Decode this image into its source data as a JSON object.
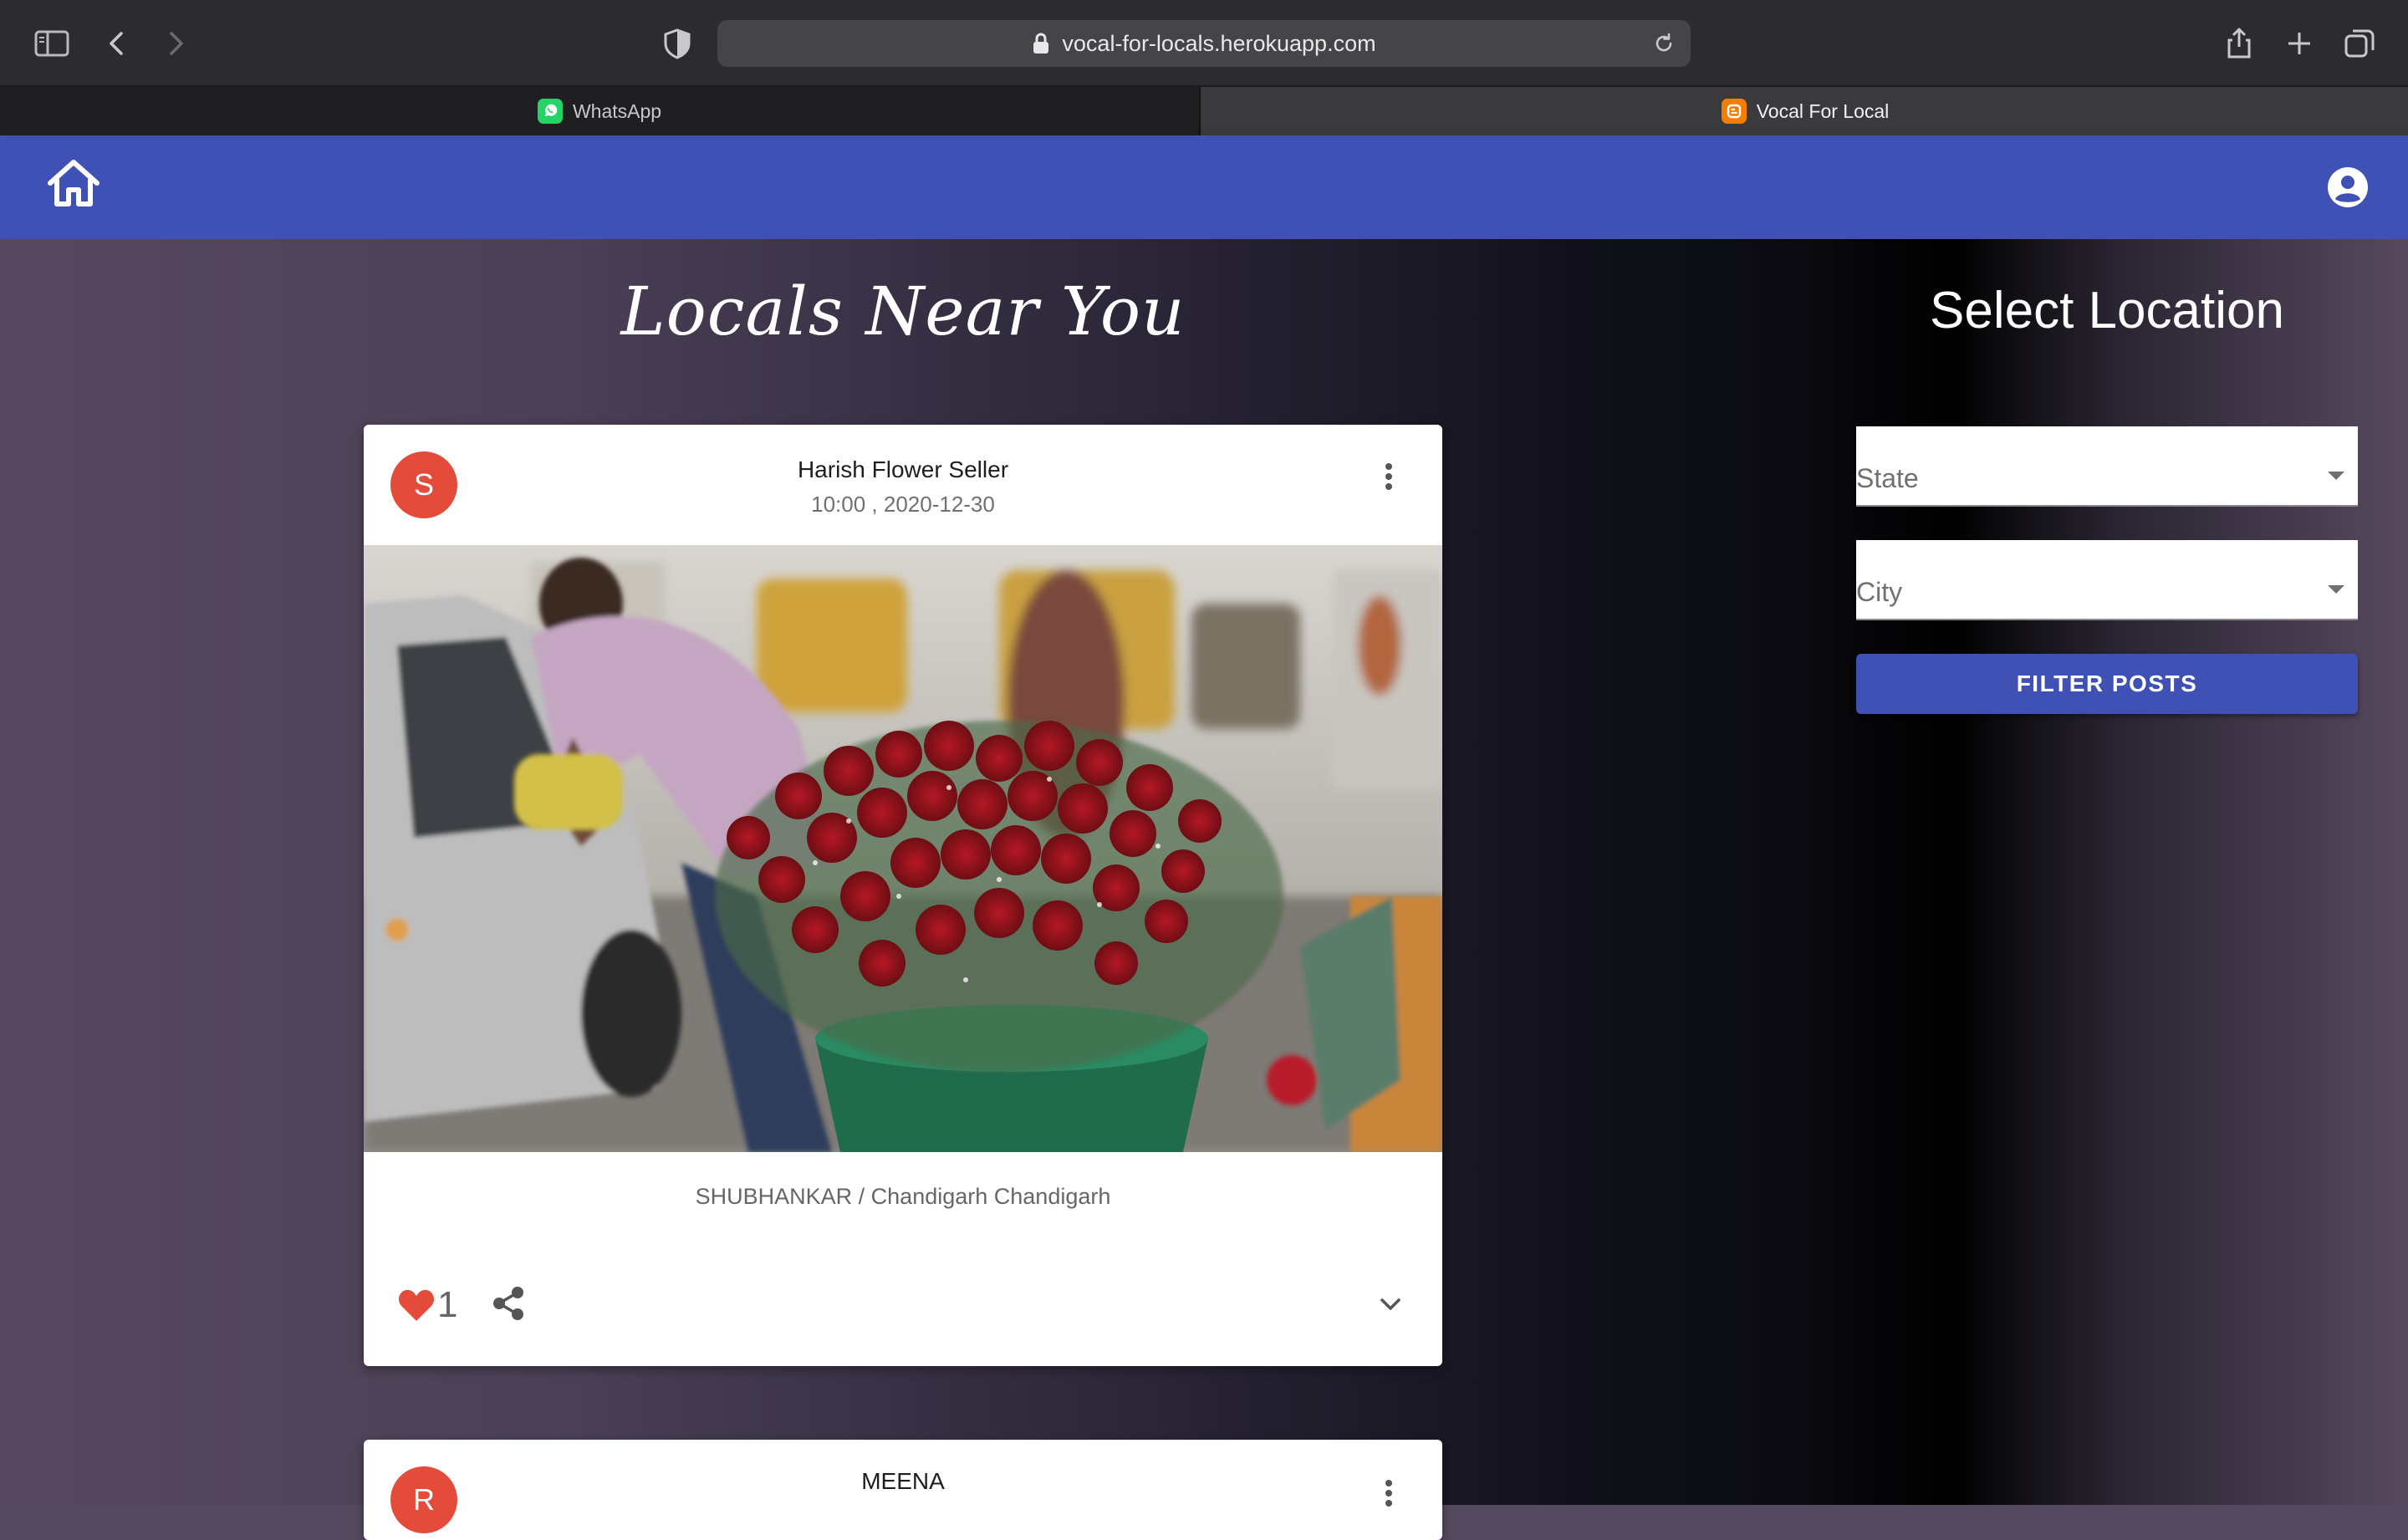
{
  "browser": {
    "url": "vocal-for-locals.herokuapp.com",
    "tabs": [
      {
        "label": "WhatsApp",
        "favicon": "whatsapp-icon",
        "active": false
      },
      {
        "label": "Vocal For Local",
        "favicon": "blogger-icon",
        "active": true
      }
    ]
  },
  "appbar": {
    "color": "#3f51b5",
    "home_icon": "home-icon",
    "account_icon": "account-circle-icon"
  },
  "main": {
    "title": "Locals Near You",
    "posts": [
      {
        "avatar_letter": "S",
        "title": "Harish Flower Seller",
        "subtitle": "10:00 , 2020-12-30",
        "body": "SHUBHANKAR / Chandigarh Chandigarh",
        "likes": "1"
      },
      {
        "avatar_letter": "R",
        "title": "MEENA"
      }
    ]
  },
  "sidebar": {
    "title": "Select Location",
    "state_label": "State",
    "city_label": "City",
    "filter_button": "FILTER POSTS"
  },
  "colors": {
    "primary": "#3f51b5",
    "avatar": "#e54b3a",
    "like": "#e54b3a"
  }
}
